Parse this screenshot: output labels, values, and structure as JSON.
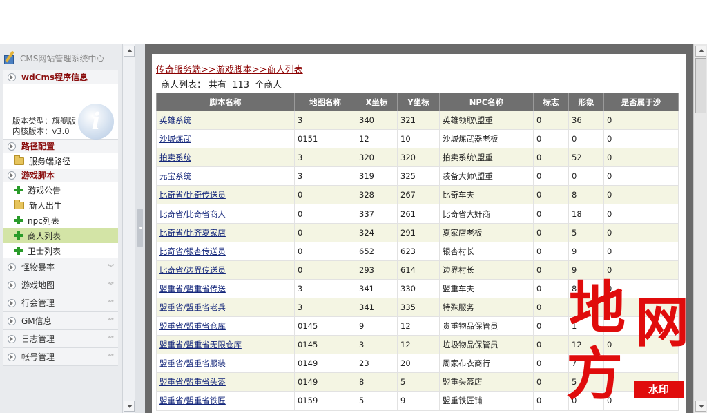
{
  "sidebar": {
    "title": "CMS网站管理系统中心",
    "sections": {
      "program_info": "wdCms程序信息",
      "path_config": "路径配置",
      "game_script": "游戏脚本"
    },
    "info": {
      "version_type_label": "版本类型：",
      "version_type_value": "旗舰版",
      "kernel_label": "内核版本：",
      "kernel_value": "v3.0"
    },
    "path_items": [
      "服务端路径"
    ],
    "script_items": [
      "游戏公告",
      "新人出生",
      "npc列表",
      "商人列表",
      "卫士列表"
    ],
    "folds": [
      "怪物暴率",
      "游戏地图",
      "行会管理",
      "GM信息",
      "日志管理",
      "帐号管理"
    ]
  },
  "main": {
    "breadcrumb": [
      "传奇服务端",
      "游戏脚本",
      "商人列表"
    ],
    "breadcrumb_sep": ">>",
    "summary": {
      "prefix": "商人列表：",
      "middle": "共有",
      "count": "113",
      "suffix": "个商人"
    },
    "columns": [
      "脚本名称",
      "地图名称",
      "X坐标",
      "Y坐标",
      "NPC名称",
      "标志",
      "形象",
      "是否属于沙"
    ],
    "rows": [
      [
        "英雄系统",
        "3",
        "340",
        "321",
        "英雄领取\\盟重",
        "0",
        "36",
        "0"
      ],
      [
        "沙城炼武",
        "0151",
        "12",
        "10",
        "沙城炼武器老板",
        "0",
        "0",
        "0"
      ],
      [
        "拍卖系统",
        "3",
        "320",
        "320",
        "拍卖系统\\盟重",
        "0",
        "52",
        "0"
      ],
      [
        "元宝系统",
        "3",
        "319",
        "325",
        "装备大师\\盟重",
        "0",
        "0",
        "0"
      ],
      [
        "比奇省/比奇传送员",
        "0",
        "328",
        "267",
        "比奇车夫",
        "0",
        "8",
        "0"
      ],
      [
        "比奇省/比奇省商人",
        "0",
        "337",
        "261",
        "比奇省大奸商",
        "0",
        "18",
        "0"
      ],
      [
        "比奇省/比齐夏家店",
        "0",
        "324",
        "291",
        "夏家店老板",
        "0",
        "5",
        "0"
      ],
      [
        "比奇省/银杏传送员",
        "0",
        "652",
        "623",
        "银杏村长",
        "0",
        "9",
        "0"
      ],
      [
        "比奇省/边界传送员",
        "0",
        "293",
        "614",
        "边界村长",
        "0",
        "9",
        "0"
      ],
      [
        "盟重省/盟重省传送",
        "3",
        "341",
        "330",
        "盟重车夫",
        "0",
        "8",
        "0"
      ],
      [
        "盟重省/盟重省老兵",
        "3",
        "341",
        "335",
        "特殊服务",
        "0",
        "",
        ""
      ],
      [
        "盟重省/盟重省仓库",
        "0145",
        "9",
        "12",
        "贵重物品保管员",
        "0",
        "1",
        ""
      ],
      [
        "盟重省/盟重省无限仓库",
        "0145",
        "3",
        "12",
        "垃圾物品保管员",
        "0",
        "12",
        "0"
      ],
      [
        "盟重省/盟重省服装",
        "0149",
        "23",
        "20",
        "周家布衣商行",
        "0",
        "7",
        ""
      ],
      [
        "盟重省/盟重省头盔",
        "0149",
        "8",
        "5",
        "盟重头盔店",
        "0",
        "5",
        ""
      ],
      [
        "盟重省/盟重省铁匠",
        "0159",
        "5",
        "9",
        "盟重铁匠铺",
        "0",
        "0",
        "0"
      ]
    ]
  },
  "watermark": {
    "chars": [
      "地",
      "网",
      "方"
    ],
    "tag": "水印"
  },
  "colors": {
    "link_red": "#8b0000",
    "link_blue": "#14277b",
    "header_bg": "#6f6f6f",
    "row_alt": "#f4f5e3",
    "active_item": "#d3e4a6",
    "watermark_red": "#e00c0c"
  }
}
